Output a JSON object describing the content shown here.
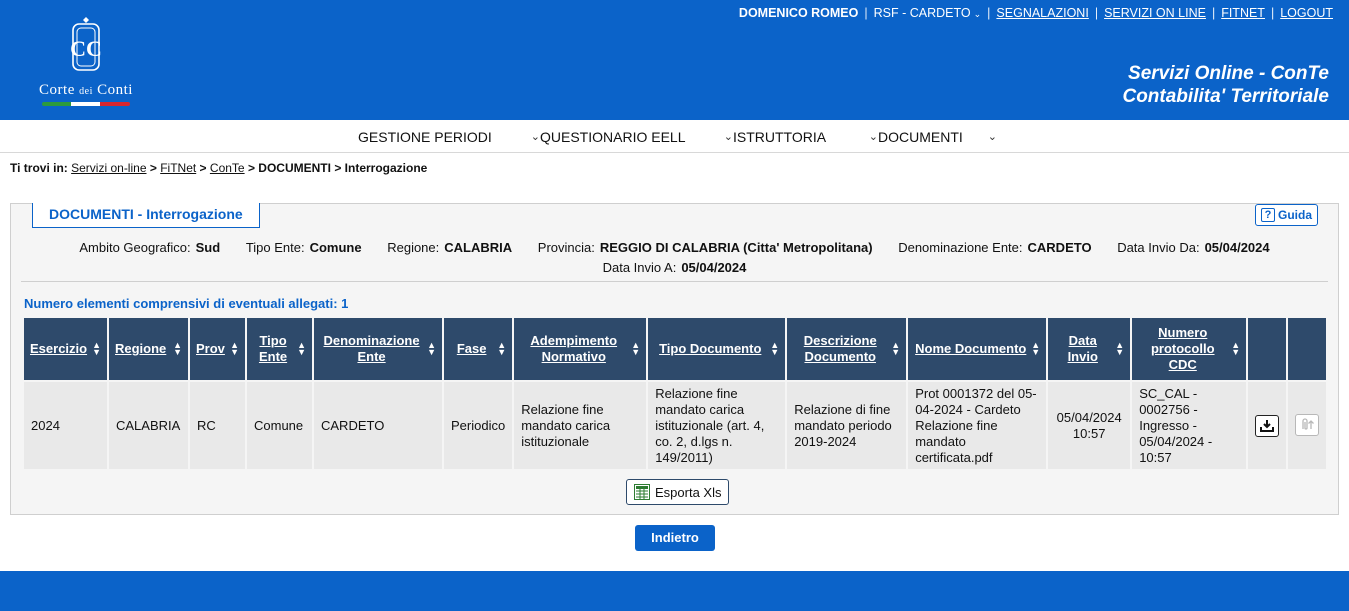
{
  "header": {
    "logo_main": "Corte",
    "logo_small": "dei",
    "logo_end": "Conti",
    "user": "DOMENICO ROMEO",
    "rsf": "RSF  - CARDETO",
    "links": [
      "SEGNALAZIONI",
      "SERVIZI ON LINE",
      "FITNET",
      "LOGOUT"
    ],
    "title_line1": "Servizi Online - ConTe",
    "title_line2": "Contabilita' Territoriale"
  },
  "nav": {
    "items": [
      "GESTIONE PERIODI",
      "QUESTIONARIO EELL",
      "ISTRUTTORIA",
      "DOCUMENTI"
    ]
  },
  "breadcrumb": {
    "prefix": "Ti trovi in:",
    "links": [
      "Servizi on-line",
      "FiTNet",
      "ConTe"
    ],
    "current1": "DOCUMENTI",
    "current2": "Interrogazione",
    "sep": ">"
  },
  "panel": {
    "tab_title": "DOCUMENTI - Interrogazione",
    "guida_label": "Guida",
    "filters": [
      {
        "label": "Ambito Geografico:",
        "value": "Sud"
      },
      {
        "label": "Tipo Ente:",
        "value": "Comune"
      },
      {
        "label": "Regione:",
        "value": "CALABRIA"
      },
      {
        "label": "Provincia:",
        "value": "REGGIO DI CALABRIA (Citta' Metropolitana)"
      },
      {
        "label": "Denominazione Ente:",
        "value": "CARDETO"
      },
      {
        "label": "Data Invio Da:",
        "value": "05/04/2024"
      },
      {
        "label": "Data Invio A:",
        "value": "05/04/2024"
      }
    ],
    "count_text": "Numero elementi comprensivi di eventuali allegati: 1",
    "export_label": "Esporta Xls"
  },
  "table": {
    "headers": [
      "Esercizio",
      "Regione",
      "Prov",
      "Tipo Ente",
      "Denominazione Ente",
      "Fase",
      "Adempimento Normativo",
      "Tipo Documento",
      "Descrizione Documento",
      "Nome Documento",
      "Data Invio",
      "Numero protocollo CDC"
    ],
    "rows": [
      {
        "esercizio": "2024",
        "regione": "CALABRIA",
        "prov": "RC",
        "tipo_ente": "Comune",
        "denominazione": "CARDETO",
        "fase": "Periodico",
        "adempimento": "Relazione fine mandato carica istituzionale",
        "tipo_documento": "Relazione fine mandato carica istituzionale (art. 4, co. 2, d.lgs n. 149/2011)",
        "descrizione": "Relazione di fine mandato periodo 2019-2024",
        "nome_documento": "Prot 0001372 del 05-04-2024 - Cardeto Relazione fine mandato certificata.pdf",
        "data_invio": "05/04/2024 10:57",
        "protocollo": "SC_CAL - 0002756 - Ingresso - 05/04/2024 - 10:57"
      }
    ]
  },
  "actions": {
    "back_label": "Indietro"
  },
  "colors": {
    "brand_blue": "#0b63c9",
    "table_header": "#2e4a6b",
    "row_bg": "#e9e9e9"
  }
}
